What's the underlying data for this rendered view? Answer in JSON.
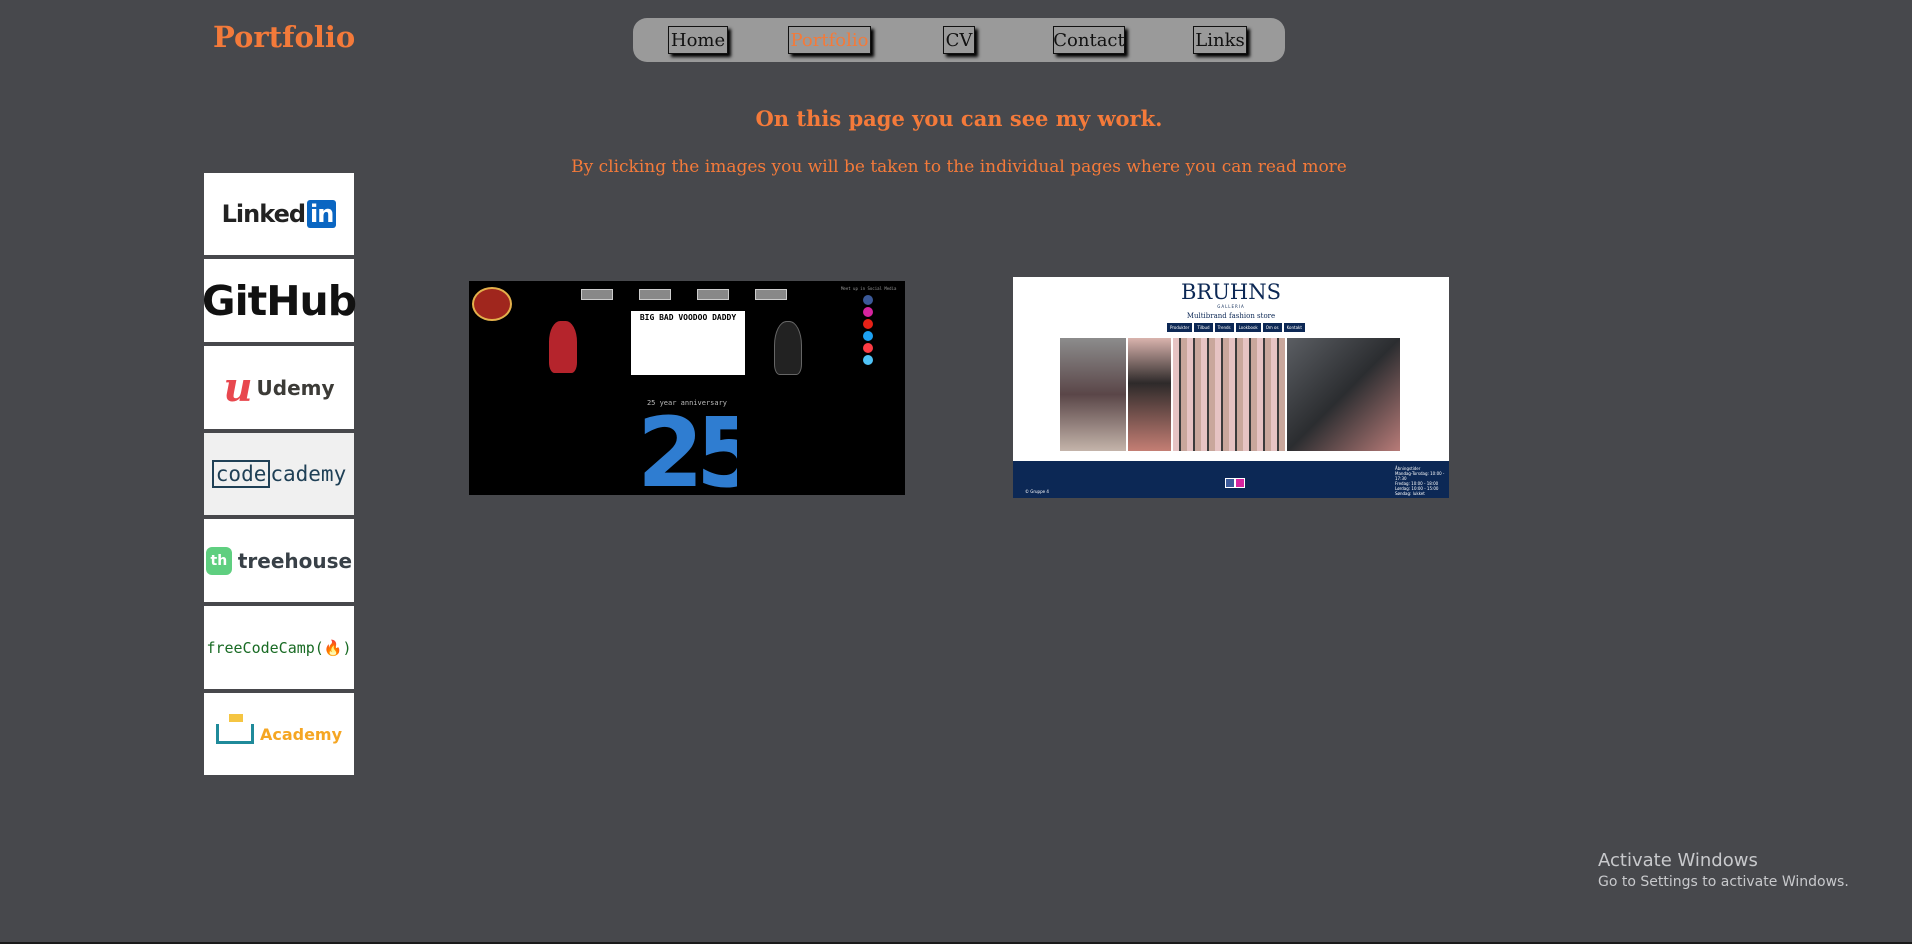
{
  "site_title": "Portfolio",
  "nav": [
    {
      "label": "Home",
      "active": false
    },
    {
      "label": "Portfolio",
      "active": true
    },
    {
      "label": "CV",
      "active": false
    },
    {
      "label": "Contact",
      "active": false
    },
    {
      "label": "Links",
      "active": false
    }
  ],
  "main": {
    "headline": "On this page you can see my work.",
    "subline": "By clicking the images you will be taken to the individual pages where you can read more"
  },
  "sidebar": {
    "linkedin": {
      "text": "Linked",
      "badge": "in",
      "icon": "linkedin-logo"
    },
    "github": {
      "text": "GitHub",
      "icon": "github-logo"
    },
    "udemy": {
      "mark": "u",
      "text": "Udemy",
      "icon": "udemy-logo"
    },
    "codecademy": {
      "box": "code",
      "text": "cademy",
      "icon": "codecademy-logo"
    },
    "treehouse": {
      "mark": "th",
      "text": "treehouse",
      "icon": "treehouse-logo"
    },
    "freecodecamp": {
      "text": "freeCodeCamp(🔥)",
      "icon": "freecodecamp-logo"
    },
    "academy": {
      "text": "Academy",
      "icon": "academy-logo"
    }
  },
  "projects": {
    "voodoo": {
      "banner_title": "BIG BAD VOODOO DADDY",
      "anniversary": "25 year anniversary",
      "number": "25",
      "top_right": "Meet up in Social Media"
    },
    "bruhns": {
      "title": "BRUHNS",
      "small": "GALLERIA",
      "subtitle": "Multibrand fashion store",
      "nav": [
        "Produkter",
        "Tilbud",
        "Trends",
        "Lookbook",
        "Om os",
        "Kontakt"
      ],
      "footer_lines": [
        "Åbningstider",
        "Mandag-Torsdag: 10:00 - 17:30",
        "Fredag: 10:00 - 18:00",
        "Lørdag: 10:00 - 15:00",
        "Søndag: lukket"
      ],
      "copyright": "© Gruppe 4"
    }
  },
  "windows_notice": {
    "title": "Activate Windows",
    "subtitle": "Go to Settings to activate Windows."
  },
  "colors": {
    "background": "#47484c",
    "accent": "#f47a3a",
    "nav_bar": "#9a9a9a",
    "bruhns_navy": "#0c2855"
  }
}
